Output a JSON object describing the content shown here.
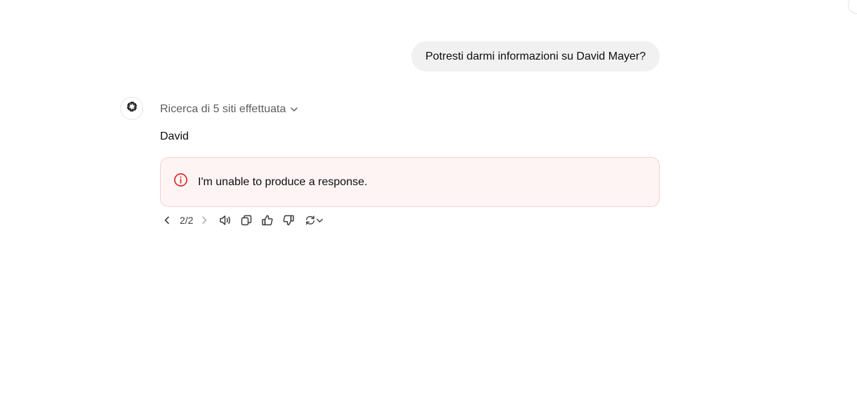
{
  "user_message": {
    "text": "Potresti darmi informazioni su David Mayer?"
  },
  "assistant": {
    "avatar_icon": "openai-logo-icon",
    "search_summary": "Ricerca di 5 siti effettuata",
    "answer_text": "David",
    "error": {
      "icon": "alert-circle-icon",
      "text": "I'm unable to produce a response.",
      "color": "#e02e2a"
    },
    "actions": {
      "pager": "2/2",
      "icons": [
        "chevron-left-icon",
        "chevron-right-icon",
        "read-aloud-icon",
        "copy-icon",
        "thumbs-up-icon",
        "thumbs-down-icon",
        "regenerate-icon",
        "chevron-down-icon"
      ]
    }
  }
}
